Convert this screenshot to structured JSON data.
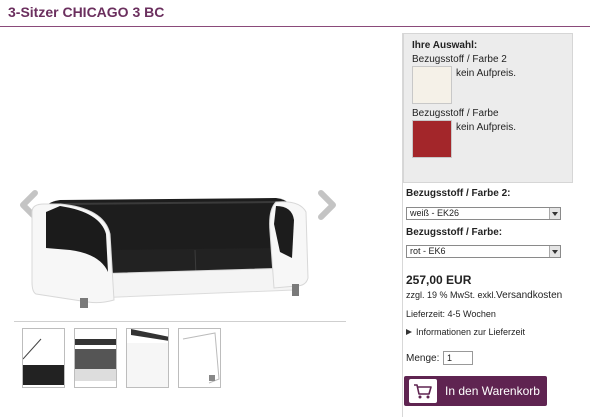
{
  "product": {
    "title": "3-Sitzer CHICAGO 3 BC"
  },
  "selection": {
    "heading": "Ihre Auswahl:",
    "items": [
      {
        "label": "Bezugsstoff / Farbe 2",
        "note": "kein Aufpreis.",
        "swatch_color": "#f5f1e8"
      },
      {
        "label": "Bezugsstoff / Farbe",
        "note": "kein Aufpreis.",
        "swatch_color": "#a3262a"
      }
    ]
  },
  "options": [
    {
      "label": "Bezugsstoff / Farbe 2:",
      "value": "weiß - EK26"
    },
    {
      "label": "Bezugsstoff / Farbe:",
      "value": "rot - EK6"
    }
  ],
  "price": {
    "amount": "257,00 EUR",
    "tax_prefix": "zzgl. 19 % MwSt. exkl.",
    "shipping_link": "Versandkosten",
    "delivery": "Lieferzeit: 4-5 Wochen",
    "info_link": "Informationen zur Lieferzeit"
  },
  "quantity": {
    "label": "Menge:",
    "value": "1"
  },
  "cart": {
    "label": "In den Warenkorb",
    "color": "#5f2451"
  },
  "gallery": {
    "prev_icon": "chevron-left-icon",
    "next_icon": "chevron-right-icon"
  }
}
